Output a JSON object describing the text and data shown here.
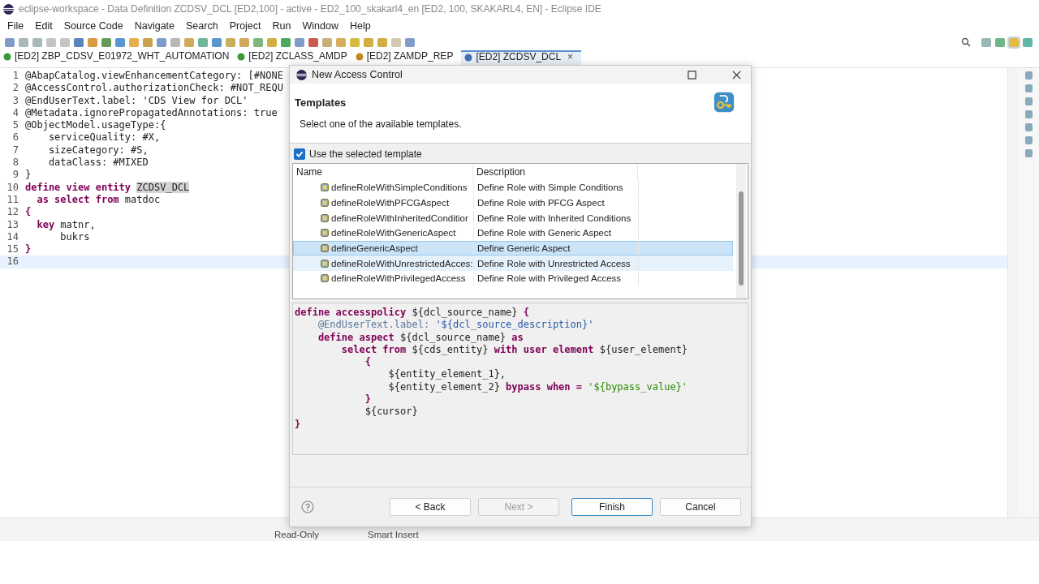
{
  "window": {
    "title": "eclipse-workspace - Data Definition ZCDSV_DCL [ED2,100] - active - ED2_100_skakarl4_en [ED2, 100, SKAKARL4, EN] - Eclipse IDE"
  },
  "menu": [
    "File",
    "Edit",
    "Source Code",
    "Navigate",
    "Search",
    "Project",
    "Run",
    "Window",
    "Help"
  ],
  "editor_tabs": [
    {
      "label": "[ED2] ZBP_CDSV_E01972_WHT_AUTOMATION",
      "color": "#3a9a3a",
      "selected": false
    },
    {
      "label": "[ED2] ZCLASS_AMDP",
      "color": "#3a9a3a",
      "selected": false
    },
    {
      "label": "[ED2] ZAMDP_REP",
      "color": "#c08a20",
      "selected": false
    },
    {
      "label": "[ED2] ZCDSV_DCL",
      "color": "#3f6fb5",
      "selected": true,
      "close": "×"
    }
  ],
  "editor": {
    "lines": [
      {
        "number": "1",
        "segs": [
          {
            "t": "@AbapCatalog.viewEnhancementCategory: [#NONE",
            "kind": "plain"
          }
        ]
      },
      {
        "number": "2",
        "segs": [
          {
            "t": "@AccessControl.authorizationCheck: #NOT_REQU",
            "kind": "plain"
          }
        ]
      },
      {
        "number": "3",
        "segs": [
          {
            "t": "@EndUserText.label: 'CDS View for DCL'",
            "kind": "plain"
          }
        ]
      },
      {
        "number": "4",
        "segs": [
          {
            "t": "@Metadata.ignorePropagatedAnnotations: true",
            "kind": "plain"
          }
        ]
      },
      {
        "number": "5",
        "segs": [
          {
            "t": "@ObjectModel.usageType:{",
            "kind": "plain"
          }
        ]
      },
      {
        "number": "6",
        "segs": [
          {
            "t": "    serviceQuality: #X,",
            "kind": "plain"
          }
        ]
      },
      {
        "number": "7",
        "segs": [
          {
            "t": "    sizeCategory: #S,",
            "kind": "plain"
          }
        ]
      },
      {
        "number": "8",
        "segs": [
          {
            "t": "    dataClass: #MIXED",
            "kind": "plain"
          }
        ]
      },
      {
        "number": "9",
        "segs": [
          {
            "t": "}",
            "kind": "plain"
          }
        ]
      },
      {
        "number": "10",
        "segs": [
          {
            "t": "define view entity ",
            "kind": "kw"
          },
          {
            "t": "ZCDSV_DCL",
            "kind": "mark"
          }
        ]
      },
      {
        "number": "11",
        "segs": [
          {
            "t": "  as select from",
            "kind": "kw"
          },
          {
            "t": " matdoc",
            "kind": "plain"
          }
        ]
      },
      {
        "number": "12",
        "segs": [
          {
            "t": "{",
            "kind": "kw"
          }
        ]
      },
      {
        "number": "13",
        "segs": [
          {
            "t": "  key",
            "kind": "kw"
          },
          {
            "t": " matnr,",
            "kind": "plain"
          }
        ]
      },
      {
        "number": "14",
        "segs": [
          {
            "t": "      bukrs",
            "kind": "plain"
          }
        ]
      },
      {
        "number": "15",
        "segs": [
          {
            "t": "}",
            "kind": "kw"
          }
        ]
      },
      {
        "number": "16",
        "current": true
      }
    ]
  },
  "status_bar": [
    "Read-Only",
    "Smart Insert"
  ],
  "dialog": {
    "title": "New Access Control",
    "heading": "Templates",
    "subtitle": "Select one of the available templates.",
    "use_template": {
      "label": "Use the selected template",
      "checked": true
    },
    "columns": [
      "Name",
      "Description"
    ],
    "rows": [
      {
        "name": "defineRoleWithSimpleConditions",
        "description": "Define Role with Simple Conditions",
        "selected": false,
        "hovered": false
      },
      {
        "name": "defineRoleWithPFCGAspect",
        "description": "Define Role with PFCG Aspect",
        "selected": false,
        "hovered": false
      },
      {
        "name": "defineRoleWithInheritedConditior",
        "description": "Define Role with Inherited Conditions",
        "selected": false,
        "hovered": false
      },
      {
        "name": "defineRoleWithGenericAspect",
        "description": "Define Role with Generic Aspect",
        "selected": false,
        "hovered": false
      },
      {
        "name": "defineGenericAspect",
        "description": "Define Generic Aspect",
        "selected": true,
        "hovered": false
      },
      {
        "name": "defineRoleWithUnrestrictedAcces:",
        "description": "Define Role with Unrestricted Access",
        "selected": false,
        "hovered": true
      },
      {
        "name": "defineRoleWithPrivilegedAccess",
        "description": "Define Role with Privileged Access",
        "selected": false,
        "hovered": false
      }
    ],
    "preview": [
      [
        {
          "t": "define accesspolicy",
          "kind": "kw"
        },
        {
          "t": " ${dcl_source_name} ",
          "kind": "plain"
        },
        {
          "t": "{",
          "kind": "kw"
        }
      ],
      [
        {
          "t": "    @EndUserText.label: ",
          "kind": "anno"
        },
        {
          "t": "'${dcl_source_description}'",
          "kind": "str"
        }
      ],
      [
        {
          "t": "    define aspect",
          "kind": "kw"
        },
        {
          "t": " ${dcl_source_name} ",
          "kind": "plain"
        },
        {
          "t": "as",
          "kind": "kw"
        }
      ],
      [
        {
          "t": "        select from",
          "kind": "kw"
        },
        {
          "t": " ${cds_entity} ",
          "kind": "plain"
        },
        {
          "t": "with user element",
          "kind": "kw"
        },
        {
          "t": " ${user_element}",
          "kind": "plain"
        }
      ],
      [
        {
          "t": "            {",
          "kind": "kw"
        }
      ],
      [
        {
          "t": "                ${entity_element_1},",
          "kind": "plain"
        }
      ],
      [
        {
          "t": "                ${entity_element_2} ",
          "kind": "plain"
        },
        {
          "t": "bypass when =",
          "kind": "kw"
        },
        {
          "t": " '${bypass_value}'",
          "kind": "green"
        }
      ],
      [
        {
          "t": "            }",
          "kind": "kw"
        }
      ],
      [
        {
          "t": "            ${cursor}",
          "kind": "plain"
        }
      ],
      [
        {
          "t": "}",
          "kind": "kw"
        }
      ]
    ],
    "buttons": [
      {
        "label": "< Back",
        "disabled": false,
        "default": false
      },
      {
        "label": "Next >",
        "disabled": true,
        "default": false
      },
      {
        "label": "Finish",
        "disabled": false,
        "default": true
      },
      {
        "label": "Cancel",
        "disabled": false,
        "default": false
      }
    ]
  }
}
